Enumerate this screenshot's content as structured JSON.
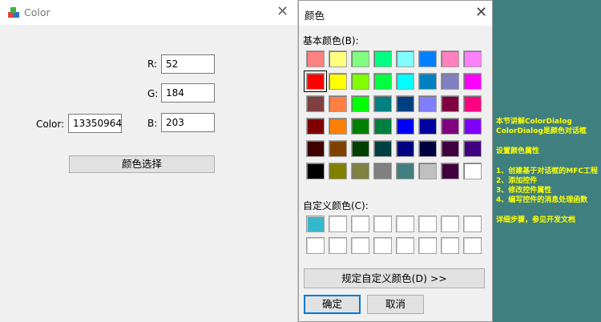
{
  "main_window": {
    "title": "Color",
    "close_glyph": "✕",
    "r_label": "R:",
    "g_label": "G:",
    "b_label": "B:",
    "color_label": "Color:",
    "r_value": "52",
    "g_value": "184",
    "b_value": "203",
    "color_value": "13350964",
    "choose_button": "颜色选择"
  },
  "dialog": {
    "title": "颜色",
    "close_glyph": "✕",
    "basic_label": "基本颜色(B):",
    "custom_label": "自定义颜色(C):",
    "define_button": "规定自定义颜色(D) >>",
    "ok_button": "确定",
    "cancel_button": "取消",
    "selected_basic": "#ff0000",
    "basic_colors": [
      [
        "#ff8080",
        "#ffff80",
        "#80ff80",
        "#00ff80",
        "#80ffff",
        "#0080ff",
        "#ff80c0",
        "#ff80ff"
      ],
      [
        "#ff0000",
        "#ffff00",
        "#80ff00",
        "#00ff40",
        "#00ffff",
        "#0080c0",
        "#8080c0",
        "#ff00ff"
      ],
      [
        "#804040",
        "#ff8040",
        "#00ff00",
        "#008080",
        "#004080",
        "#8080ff",
        "#800040",
        "#ff0080"
      ],
      [
        "#800000",
        "#ff8000",
        "#008000",
        "#008040",
        "#0000ff",
        "#0000a0",
        "#800080",
        "#8000ff"
      ],
      [
        "#400000",
        "#804000",
        "#004000",
        "#004040",
        "#000080",
        "#000040",
        "#400040",
        "#400080"
      ],
      [
        "#000000",
        "#808000",
        "#808040",
        "#808080",
        "#408080",
        "#c0c0c0",
        "#400040",
        "#ffffff"
      ]
    ],
    "custom_colors": [
      "#34b8cb",
      "#ffffff",
      "#ffffff",
      "#ffffff",
      "#ffffff",
      "#ffffff",
      "#ffffff",
      "#ffffff",
      "#ffffff",
      "#ffffff",
      "#ffffff",
      "#ffffff",
      "#ffffff",
      "#ffffff",
      "#ffffff",
      "#ffffff"
    ]
  },
  "side_notes": [
    "本节讲解ColorDialog",
    "ColorDialog是颜色对话框",
    "",
    "设置颜色属性",
    "",
    "1、创建基于对话框的MFC工程",
    "2、添加控件",
    "3、修改控件属性",
    "4、编写控件的消息处理函数",
    "",
    "详细步骤，参见开发文档"
  ],
  "colors": {
    "side_bg": "#3f7f80",
    "side_text": "#ffff00",
    "window_bg": "#f0f0f0"
  }
}
